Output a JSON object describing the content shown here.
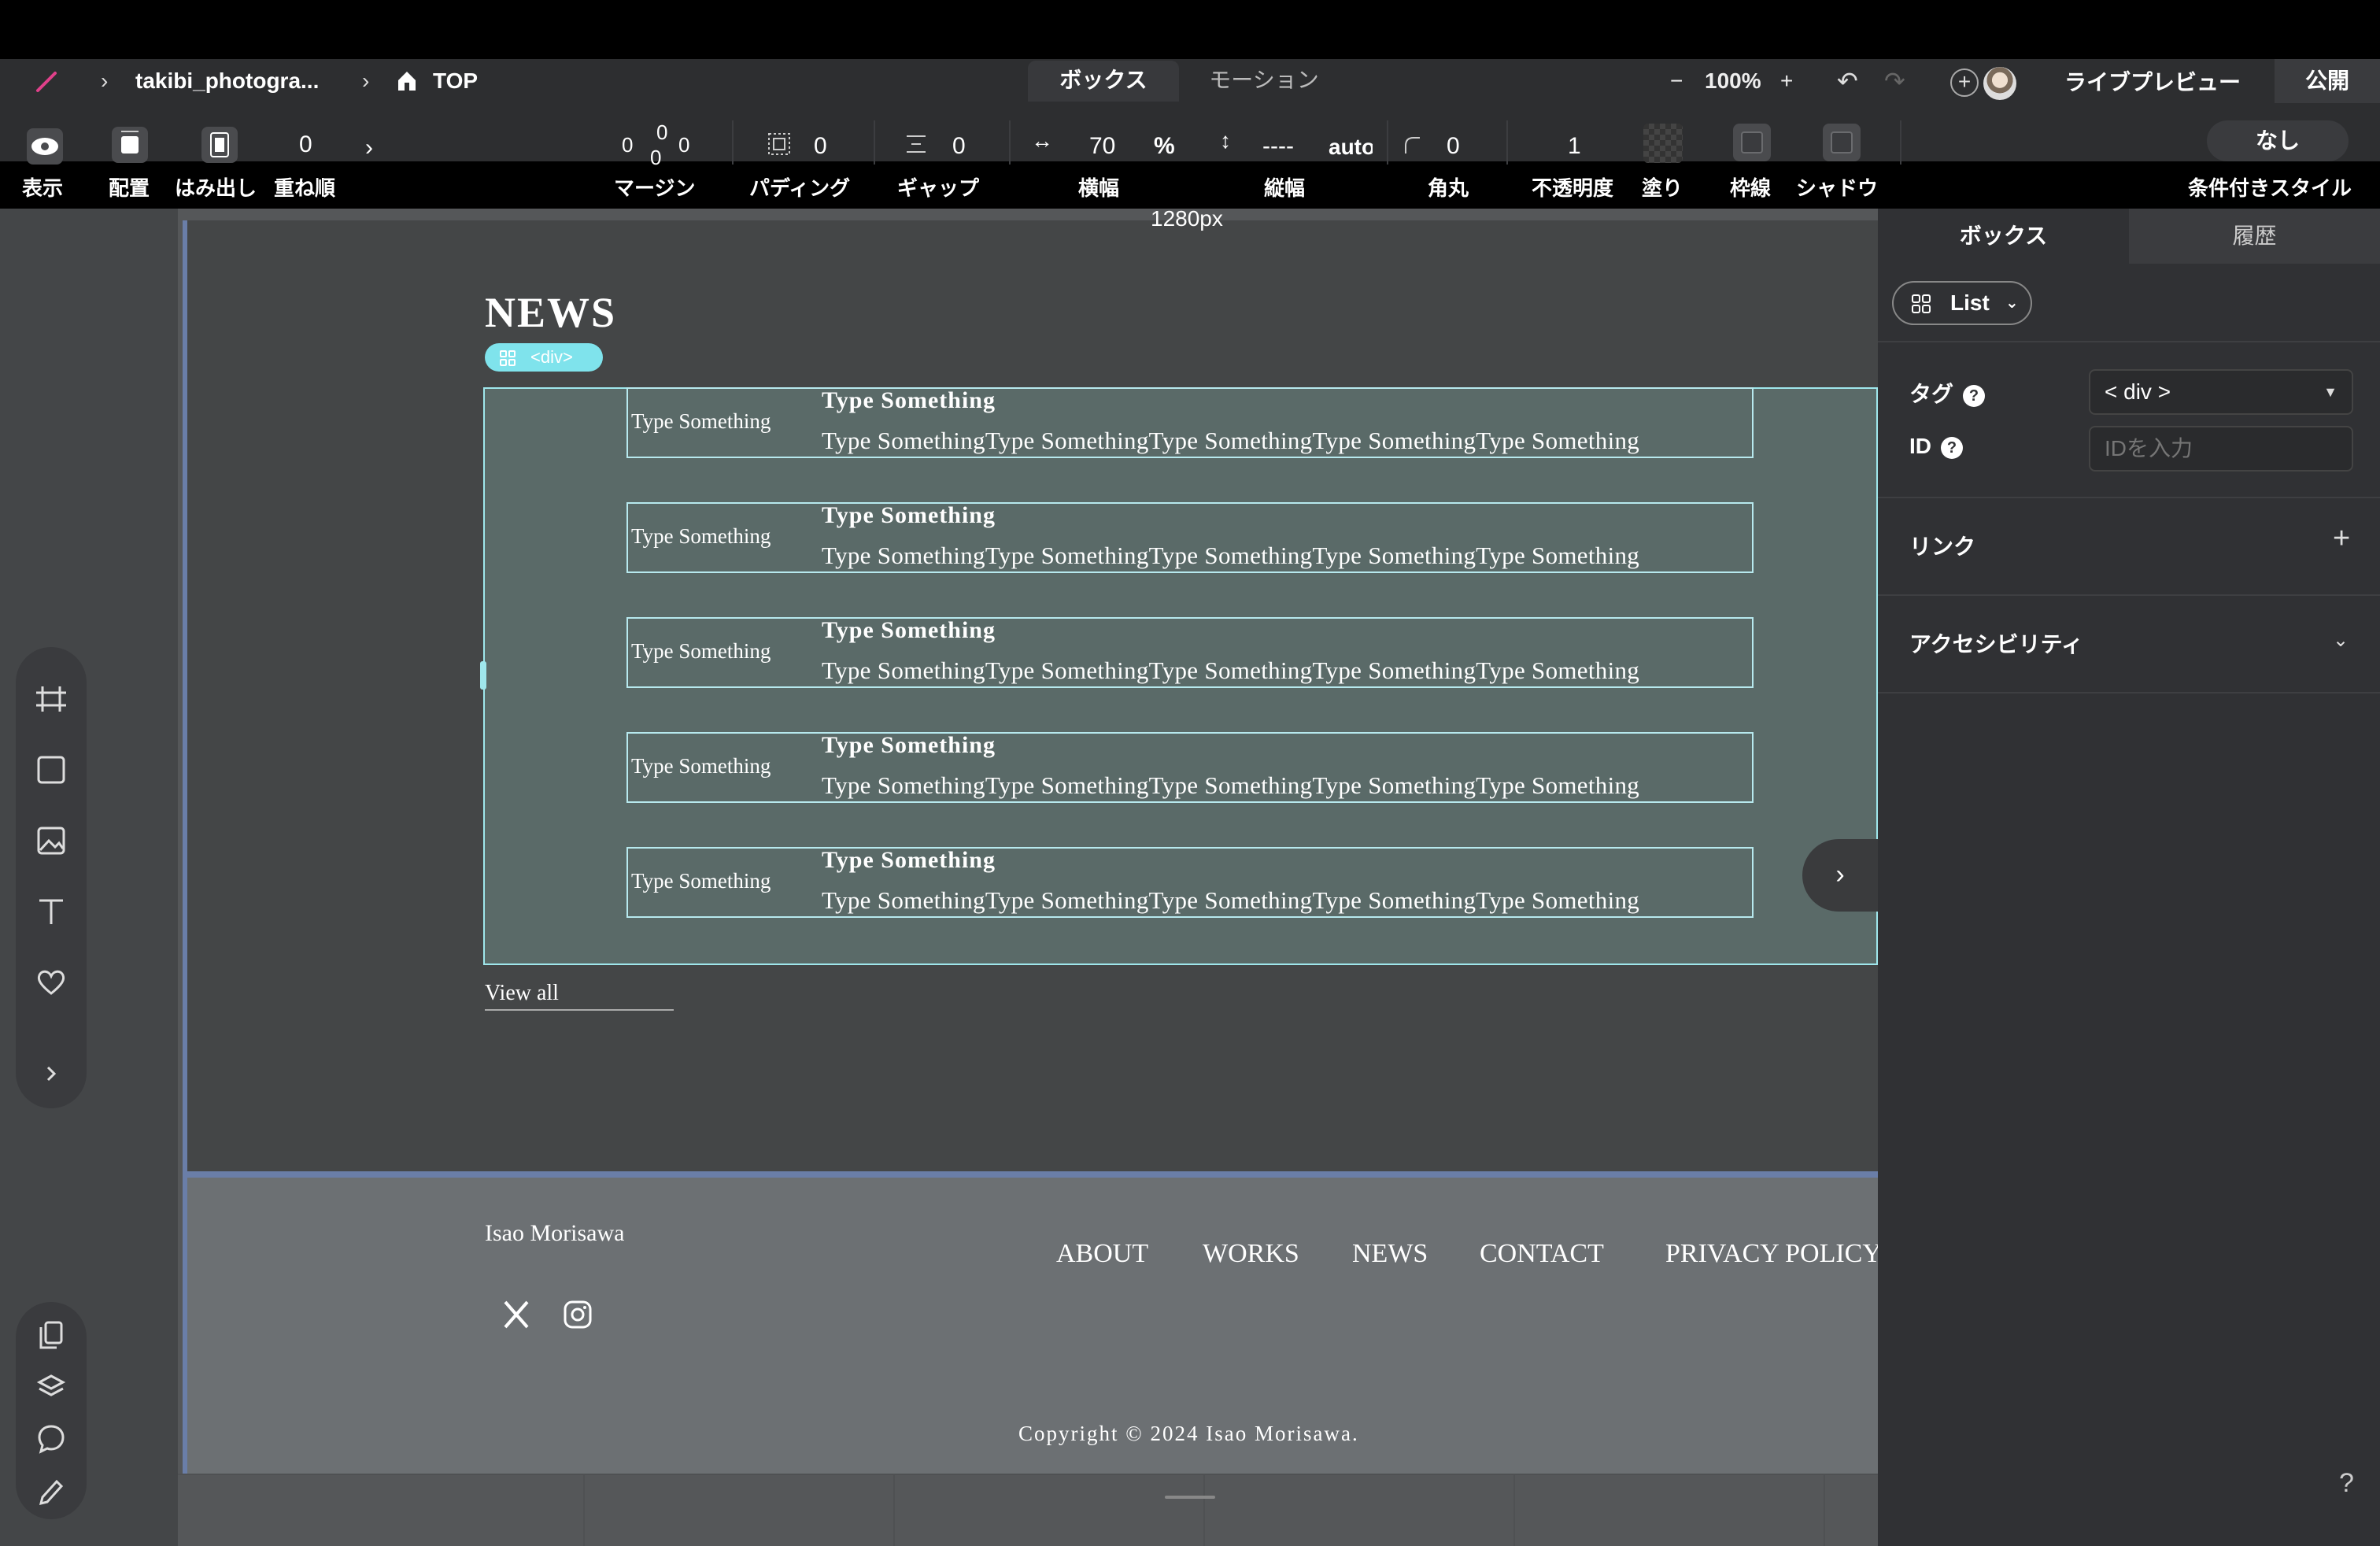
{
  "breadcrumb": {
    "project": "takibi_photogra...",
    "page": "TOP"
  },
  "mode_tabs": {
    "box": "ボックス",
    "motion": "モーション"
  },
  "zoom": {
    "minus": "−",
    "value": "100%",
    "plus": "+"
  },
  "header_actions": {
    "undo": "↶",
    "redo": "↷",
    "add": "+",
    "live_preview": "ライブプレビュー",
    "publish": "公開"
  },
  "toolbar": {
    "display": "表示",
    "arrange": "配置",
    "overflow": "はみ出し",
    "zindex_value": "0",
    "zindex_label": "重ね順",
    "more": "›",
    "margin_top": "0",
    "margin_left": "0",
    "margin_right": "0",
    "margin_bottom": "0",
    "margin_label": "マージン",
    "padding_value": "0",
    "padding_label": "パディング",
    "gap_value": "0",
    "gap_label": "ギャップ",
    "width_arrow": "↔",
    "width_value": "70",
    "width_unit": "%",
    "width_label": "横幅",
    "height_arrow": "↕",
    "height_value": "----",
    "height_unit": "auto",
    "height_label": "縦幅",
    "radius_value": "0",
    "radius_label": "角丸",
    "opacity_value": "1",
    "opacity_label": "不透明度",
    "fill_label": "塗り",
    "border_label": "枠線",
    "shadow_label": "シャドウ",
    "conditional_value": "なし",
    "conditional_label": "条件付きスタイル"
  },
  "canvas": {
    "width_label": "1280px",
    "news_title": "NEWS",
    "selection_badge": "<div>",
    "news_items": [
      {
        "date": "Type Something",
        "title": "Type Something",
        "body": "Type SomethingType SomethingType SomethingType SomethingType Something"
      },
      {
        "date": "Type Something",
        "title": "Type Something",
        "body": "Type SomethingType SomethingType SomethingType SomethingType Something"
      },
      {
        "date": "Type Something",
        "title": "Type Something",
        "body": "Type SomethingType SomethingType SomethingType SomethingType Something"
      },
      {
        "date": "Type Something",
        "title": "Type Something",
        "body": "Type SomethingType SomethingType SomethingType SomethingType Something"
      },
      {
        "date": "Type Something",
        "title": "Type Something",
        "body": "Type SomethingType SomethingType SomethingType SomethingType Something"
      }
    ],
    "next_arrow": "›",
    "view_all": "View all"
  },
  "footer": {
    "name": "Isao Morisawa",
    "nav": [
      "ABOUT",
      "WORKS",
      "NEWS",
      "CONTACT",
      "PRIVACY POLICY"
    ],
    "copyright": "Copyright © 2024 Isao Morisawa."
  },
  "right_panel": {
    "tab_box": "ボックス",
    "tab_history": "履歴",
    "component": "List",
    "tag_label": "タグ",
    "tag_value": "< div >",
    "id_label": "ID",
    "id_placeholder": "IDを入力",
    "link_label": "リンク",
    "accessibility_label": "アクセシビリティ",
    "help": "?"
  },
  "colors": {
    "selection": "#9fe7ec",
    "badge": "#7fe3ec",
    "page_border": "#6a7ea8"
  }
}
